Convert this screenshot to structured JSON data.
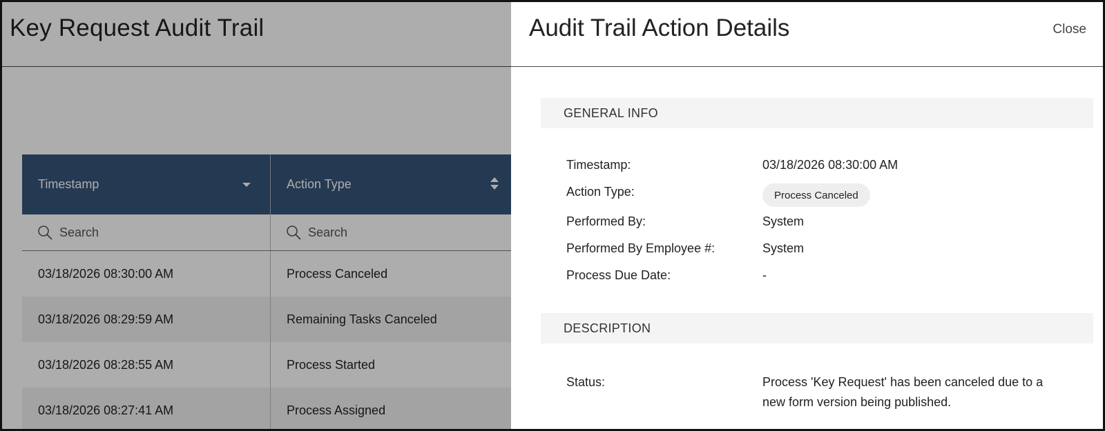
{
  "background": {
    "title": "Key Request Audit Trail",
    "table": {
      "columns": [
        {
          "label": "Timestamp",
          "sort": "desc"
        },
        {
          "label": "Action Type",
          "sort": "none"
        }
      ],
      "search_placeholder": "Search",
      "rows": [
        {
          "timestamp": "03/18/2026 08:30:00 AM",
          "action": "Process Canceled"
        },
        {
          "timestamp": "03/18/2026 08:29:59 AM",
          "action": "Remaining Tasks Canceled"
        },
        {
          "timestamp": "03/18/2026 08:28:55 AM",
          "action": "Process Started"
        },
        {
          "timestamp": "03/18/2026 08:27:41 AM",
          "action": "Process Assigned"
        }
      ]
    }
  },
  "panel": {
    "title": "Audit Trail Action Details",
    "close_label": "Close",
    "general_info": {
      "heading": "GENERAL INFO",
      "timestamp_label": "Timestamp:",
      "timestamp_value": "03/18/2026 08:30:00 AM",
      "action_type_label": "Action Type:",
      "action_type_value": "Process Canceled",
      "performed_by_label": "Performed By:",
      "performed_by_value": "System",
      "employee_label": "Performed By Employee #:",
      "employee_value": "System",
      "due_date_label": "Process Due Date:",
      "due_date_value": "-"
    },
    "description": {
      "heading": "DESCRIPTION",
      "status_label": "Status:",
      "status_value": "Process 'Key Request' has been canceled due to a new form version being published."
    }
  },
  "colors": {
    "table_header": "#36557a",
    "overlay": "rgba(0,0,0,0.32)",
    "section_bar": "#f4f4f4"
  }
}
